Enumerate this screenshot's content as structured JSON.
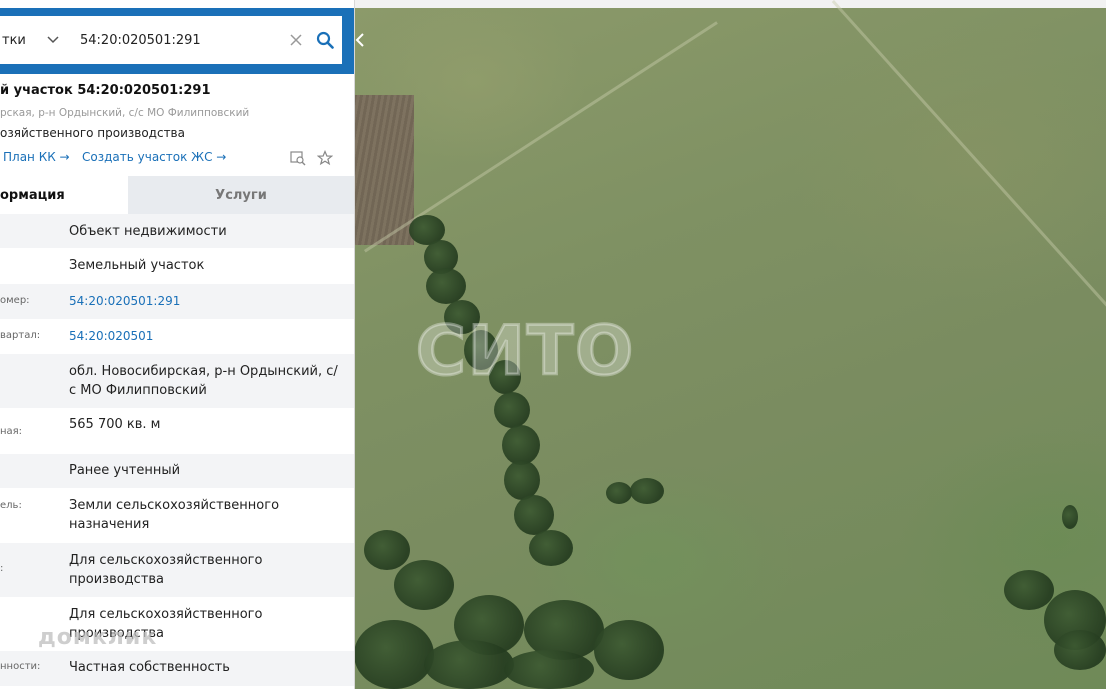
{
  "search": {
    "type_label": "тки",
    "query": "54:20:020501:291"
  },
  "parcel": {
    "title": "й участок 54:20:020501:291",
    "address_short": "рская, р-н Ордынский, с/с МО Филипповский",
    "use_short": "озяйственного производства",
    "plan_link": "План КК →",
    "create_link": "Создать участок ЖС →"
  },
  "tabs": [
    {
      "label": "ормация"
    },
    {
      "label": "Услуги"
    }
  ],
  "rows": [
    {
      "label": "",
      "value": "Объект недвижимости"
    },
    {
      "label": "",
      "value": "Земельный участок"
    },
    {
      "label": "омер:",
      "value": "54:20:020501:291"
    },
    {
      "label": "вартал:",
      "value": "54:20:020501"
    },
    {
      "label": "",
      "value": "обл. Новосибирская, р-н Ордынский, с/с МО Филипповский"
    },
    {
      "label": "ная:",
      "value": "565 700 кв. м"
    },
    {
      "label": "",
      "value": "Ранее учтенный"
    },
    {
      "label": "ель:",
      "value": "Земли сельскохозяйственного назначения"
    },
    {
      "label": ":",
      "value": "Для сельскохозяйственного производства"
    },
    {
      "label": "",
      "value": "Для сельскохозяйственного производства"
    },
    {
      "label": "нности:",
      "value": "Частная собственность"
    }
  ],
  "map": {
    "watermark": "СИТО"
  },
  "brand": "домклик",
  "colors": {
    "accent": "#1a70b8",
    "link": "#1a70b8",
    "tab_inactive_bg": "#e8ebef",
    "row_alt_bg": "#f3f4f6"
  },
  "icons": {
    "chevron": "chevron-down-icon",
    "clear": "close-icon",
    "search": "search-icon",
    "collapse": "chevron-left-icon",
    "cadastral_map": "map-search-icon",
    "favorite": "star-icon"
  }
}
